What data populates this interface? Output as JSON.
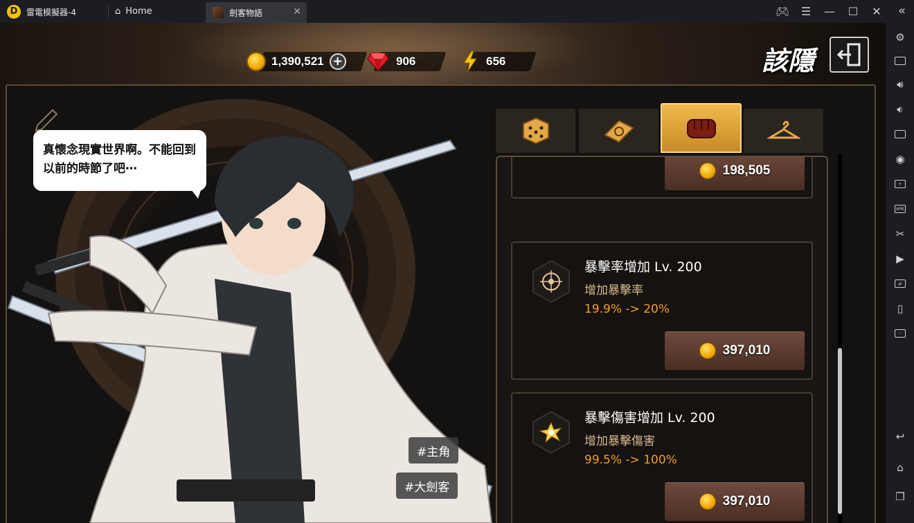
{
  "titlebar": {
    "app_name": "雷電模擬器-4",
    "home_label": "Home",
    "tab_label": "劍客物語"
  },
  "resources": {
    "gold": "1,390,521",
    "gems": "906",
    "energy": "656"
  },
  "header": {
    "hide_label": "該隱"
  },
  "character": {
    "speech": "真懷念現實世界啊。不能回到以前的時節了吧⋯",
    "tags": [
      "#主角",
      "#大劍客"
    ]
  },
  "tabs": [
    {
      "name": "dice",
      "active": false
    },
    {
      "name": "book",
      "active": false
    },
    {
      "name": "fist",
      "active": true
    },
    {
      "name": "hanger",
      "active": false
    }
  ],
  "upgrades": [
    {
      "title": "",
      "desc": "",
      "stat": "",
      "price": "198,505"
    },
    {
      "title": "暴擊率增加 Lv. 200",
      "desc": "增加暴擊率",
      "stat": "19.9% -> 20%",
      "price": "397,010",
      "icon": "crosshair-icon"
    },
    {
      "title": "暴擊傷害增加 Lv. 200",
      "desc": "增加暴擊傷害",
      "stat": "99.5% -> 100%",
      "price": "397,010",
      "icon": "impact-icon"
    }
  ],
  "colors": {
    "accent_gold": "#f0b94a",
    "stat_orange": "#f0a12a",
    "desc_tan": "#d8b991",
    "button_brown": "#5a3a2e"
  }
}
